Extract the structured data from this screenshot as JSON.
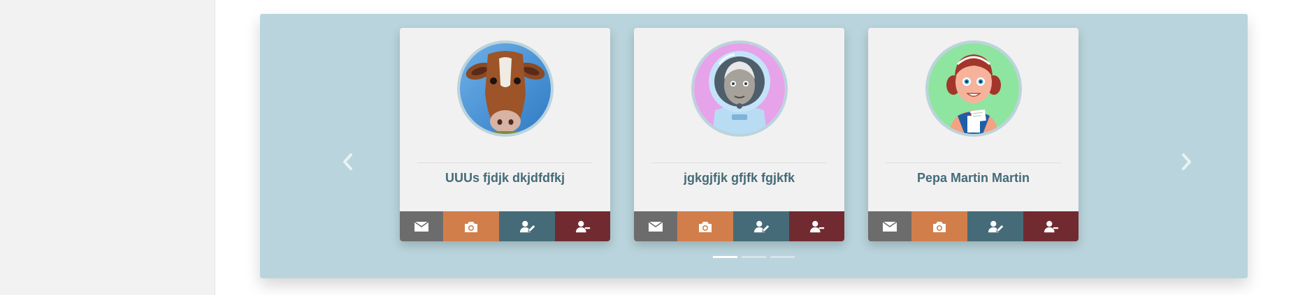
{
  "carousel": {
    "prev_icon": "chevron-left-icon",
    "next_icon": "chevron-right-icon",
    "active_slide": 1,
    "slide_count": 3,
    "background": "#b9d4dc",
    "cards": [
      {
        "name": "UUUs fjdjk dkjdfdfkj",
        "avatar": "cow-photo"
      },
      {
        "name": "jgkgjfjk gfjfk fgjkfk",
        "avatar": "astronaut-illustration"
      },
      {
        "name": "Pepa Martin Martin",
        "avatar": "woman-illustration"
      }
    ]
  },
  "actions": {
    "mail_icon": "envelope-icon",
    "photo_icon": "camera-icon",
    "edit_icon": "user-edit-icon",
    "remove_icon": "user-minus-icon"
  },
  "colors": {
    "mail": "#6c6c6c",
    "photo": "#d27e4b",
    "edit": "#456b78",
    "remove": "#722a31",
    "name_text": "#456b78"
  }
}
